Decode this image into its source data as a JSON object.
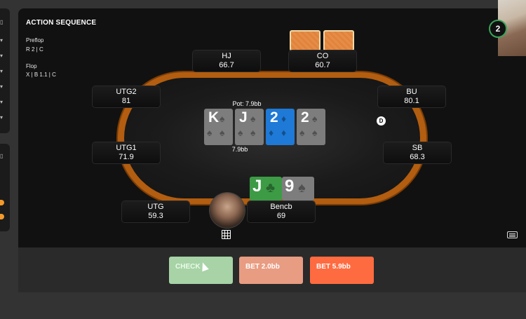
{
  "action_sequence": {
    "title": "ACTION SEQUENCE",
    "preflop_label": "Preflop",
    "preflop_actions": "R 2 | C",
    "flop_label": "Flop",
    "flop_actions": "X | B 1.1 | C"
  },
  "timer": {
    "value": "2"
  },
  "seats": {
    "hj": {
      "position": "HJ",
      "stack": "66.7"
    },
    "co": {
      "position": "CO",
      "stack": "60.7"
    },
    "utg2": {
      "position": "UTG2",
      "stack": "81"
    },
    "bu": {
      "position": "BU",
      "stack": "80.1"
    },
    "utg1": {
      "position": "UTG1",
      "stack": "71.9"
    },
    "sb": {
      "position": "SB",
      "stack": "68.3"
    },
    "utg": {
      "position": "UTG",
      "stack": "59.3"
    },
    "hero": {
      "name": "Bencb",
      "stack": "69"
    }
  },
  "pot": {
    "label": "Pot: 7.9bb",
    "amount": "7.9bb"
  },
  "board": [
    {
      "rank": "K",
      "suit": "spade",
      "color": "#7d7d7d"
    },
    {
      "rank": "J",
      "suit": "spade",
      "color": "#7d7d7d"
    },
    {
      "rank": "2",
      "suit": "diamond",
      "color": "#1e7ad6"
    },
    {
      "rank": "2",
      "suit": "spade",
      "color": "#7d7d7d"
    }
  ],
  "hero_cards": [
    {
      "rank": "J",
      "suit": "club",
      "color": "#3d9b45"
    },
    {
      "rank": "9",
      "suit": "spade",
      "color": "#7d7d7d"
    }
  ],
  "dealer_button": {
    "label": "D"
  },
  "actions": {
    "check": "CHECK",
    "bet_small": "BET 2.0bb",
    "bet_large": "BET 5.9bb"
  },
  "icons": {
    "grid": "grid-icon",
    "keyboard": "keyboard-icon",
    "cursor": "cursor-icon"
  }
}
